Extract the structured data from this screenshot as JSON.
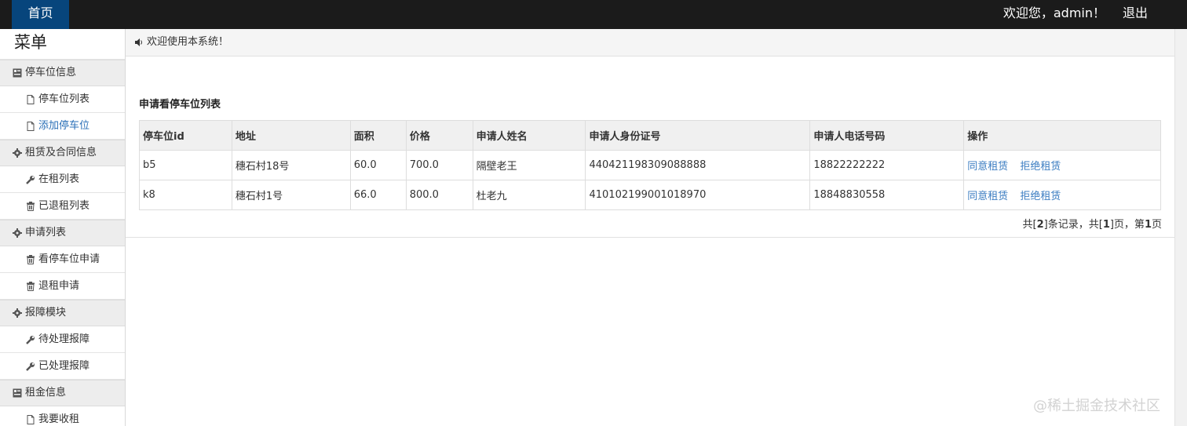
{
  "header": {
    "home_tab": "首页",
    "welcome": "欢迎您，admin！",
    "logout": "退出"
  },
  "sidebar": {
    "title": "菜单",
    "groups": [
      {
        "label": "停车位信息",
        "icon": "list-box-icon",
        "items": [
          {
            "label": "停车位列表",
            "icon": "file-icon"
          },
          {
            "label": "添加停车位",
            "icon": "file-icon"
          }
        ]
      },
      {
        "label": "租赁及合同信息",
        "icon": "gear-icon",
        "items": [
          {
            "label": "在租列表",
            "icon": "wrench-icon"
          },
          {
            "label": "已退租列表",
            "icon": "trash-icon"
          }
        ]
      },
      {
        "label": "申请列表",
        "icon": "gear-icon",
        "items": [
          {
            "label": "看停车位申请",
            "icon": "trash-icon"
          },
          {
            "label": "退租申请",
            "icon": "trash-icon"
          }
        ]
      },
      {
        "label": "报障模块",
        "icon": "gear-icon",
        "items": [
          {
            "label": "待处理报障",
            "icon": "wrench-icon"
          },
          {
            "label": "已处理报障",
            "icon": "wrench-icon"
          }
        ]
      },
      {
        "label": "租金信息",
        "icon": "list-box-icon",
        "items": [
          {
            "label": "我要收租",
            "icon": "file-icon"
          }
        ]
      }
    ]
  },
  "notice": {
    "text": "欢迎使用本系统！"
  },
  "panel": {
    "title": "申请看停车位列表",
    "columns": [
      "停车位id",
      "地址",
      "面积",
      "价格",
      "申请人姓名",
      "申请人身份证号",
      "申请人电话号码",
      "操作"
    ],
    "rows": [
      {
        "id": "b5",
        "address": "穗石村18号",
        "area": "60.0",
        "price": "700.0",
        "name": "隔壁老王",
        "idcard": "440421198309088888",
        "phone": "18822222222",
        "agree": "同意租赁",
        "reject": "拒绝租赁"
      },
      {
        "id": "k8",
        "address": "穗石村1号",
        "area": "66.0",
        "price": "800.0",
        "name": "杜老九",
        "idcard": "410102199001018970",
        "phone": "18848830558",
        "agree": "同意租赁",
        "reject": "拒绝租赁"
      }
    ],
    "pager": {
      "prefix": "共[",
      "records": "2",
      "mid1": "]条记录，共[",
      "pages": "1",
      "mid2": "]页，第",
      "current": "1",
      "suffix": "页"
    }
  },
  "watermark": "@稀土掘金技术社区",
  "colors": {
    "topbar": "#1b1b1b",
    "home_tab": "#07457c",
    "link": "#3d7ec2"
  }
}
